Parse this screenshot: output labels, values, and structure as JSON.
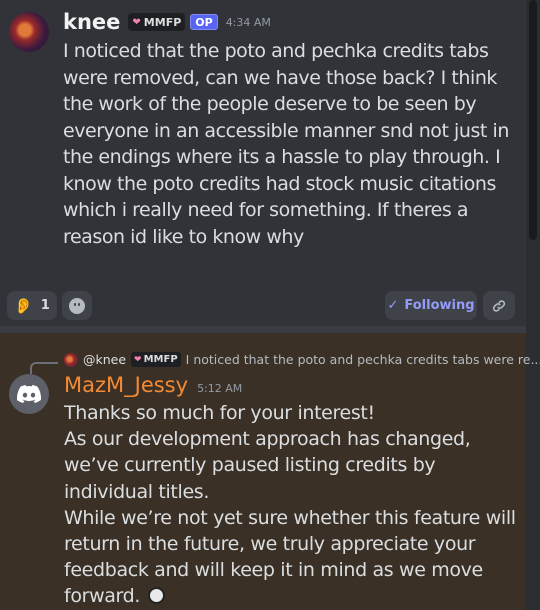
{
  "message_op": {
    "username": "knee",
    "tag": "MMFP",
    "op_badge": "OP",
    "time": "4:34 AM",
    "text": "I noticed that the poto and pechka credits tabs were removed, can we have those back? I think the work of the people deserve to be seen by everyone in an accessible manner snd not just in the endings where its a hassle to play through. I know the poto credits had stock music citations which i really need for something. If theres a reason id like to know why",
    "reaction": {
      "emoji": "👂",
      "count": "1"
    },
    "following_label": "Following"
  },
  "reply": {
    "mention": "@knee",
    "tag": "MMFP",
    "snippet": "I noticed that the poto and pechka credits tabs were re..."
  },
  "message_reply": {
    "username": "MazM_Jessy",
    "time": "5:12 AM",
    "paragraphs": [
      "Thanks so much for your interest!",
      "As our development approach has changed, we’ve currently paused listing credits by individual titles.",
      "While we’re not yet sure whether this feature will return in the future, we truly appreciate your feedback and will keep it in mind as we move forward."
    ]
  },
  "colors": {
    "accent_blurple": "#5865f2",
    "following": "#949cf7",
    "mazm_name": "#f48a33",
    "highlight_bg": "#3a3026"
  }
}
